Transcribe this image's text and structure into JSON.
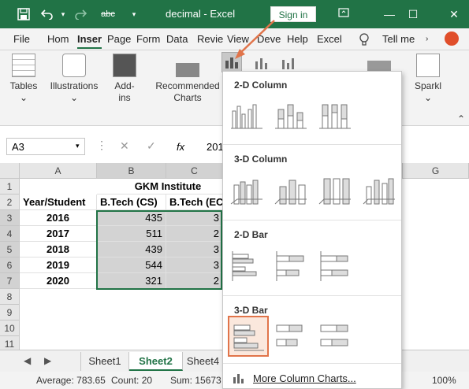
{
  "titlebar": {
    "title": "decimal  -  Excel",
    "signin": "Sign in",
    "undo_label": "abc"
  },
  "ribbon_tabs": [
    "File",
    "Hom",
    "Inser",
    "Page",
    "Form",
    "Data",
    "Revie",
    "View",
    "Deve",
    "Help",
    "Excel"
  ],
  "tellme": "Tell me",
  "ribbon_groups": {
    "tables": [
      "Tables"
    ],
    "illustrations": [
      "Illustrations"
    ],
    "addins": [
      "Add-",
      "ins"
    ],
    "recommended": [
      "Recommended",
      "Charts"
    ],
    "sparklines": [
      "Sparkl"
    ]
  },
  "formula": {
    "namebox": "A3",
    "fx": "fx",
    "value": "201"
  },
  "columns": [
    "A",
    "B",
    "C",
    "G"
  ],
  "rows": [
    "1",
    "2",
    "3",
    "4",
    "5",
    "6",
    "7",
    "8",
    "9",
    "10",
    "11"
  ],
  "sheet": {
    "title": "GKM Institute",
    "headers": [
      "Year/Student",
      "B.Tech (CS)",
      "B.Tech (EC)"
    ],
    "years": [
      "2016",
      "2017",
      "2018",
      "2019",
      "2020"
    ],
    "cs": [
      "435",
      "511",
      "439",
      "544",
      "321"
    ],
    "ec_partial": [
      "3",
      "2",
      "3",
      "3",
      "2"
    ]
  },
  "sheet_tabs": [
    "Sheet1",
    "Sheet2",
    "Sheet4"
  ],
  "status": {
    "average": "Average: 783.65",
    "count": "Count: 20",
    "sum": "Sum: 15673",
    "zoom": "100%"
  },
  "dropdown": {
    "sections": [
      "2-D Column",
      "3-D Column",
      "2-D Bar",
      "3-D Bar"
    ],
    "more": "More Column Charts..."
  },
  "colors": {
    "excel_green": "#217346",
    "highlight_border": "#e1744a",
    "selection_gray": "#d3d3d3"
  }
}
